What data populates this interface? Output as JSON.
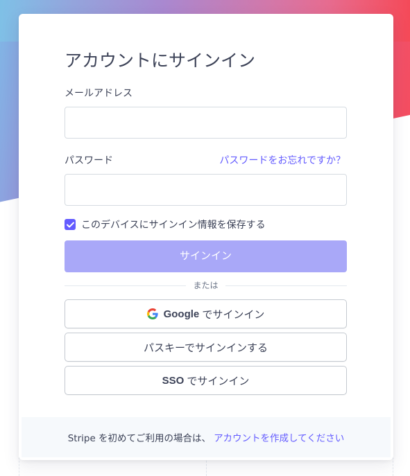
{
  "page": {
    "title": "アカウントにサインイン"
  },
  "email": {
    "label": "メールアドレス",
    "value": ""
  },
  "password": {
    "label": "パスワード",
    "forgot_link": "パスワードをお忘れですか？",
    "value": ""
  },
  "remember": {
    "label": "このデバイスにサインイン情報を保存する",
    "checked": true
  },
  "signin_button": "サインイン",
  "divider_text": "または",
  "alt_signin": {
    "google_brand": "Google",
    "google_suffix": " でサインイン",
    "passkey_label": "パスキーでサインインする",
    "sso_brand": "SSO",
    "sso_suffix": " でサインイン"
  },
  "footer": {
    "text": "Stripe を初めてご利用の場合は、",
    "link": "アカウントを作成してください"
  },
  "colors": {
    "accent": "#635bff",
    "primary_disabled": "#a9a8f8",
    "text": "#3c4257"
  },
  "icons": {
    "google": "google-logo-icon",
    "checkbox": "checkmark-icon"
  }
}
